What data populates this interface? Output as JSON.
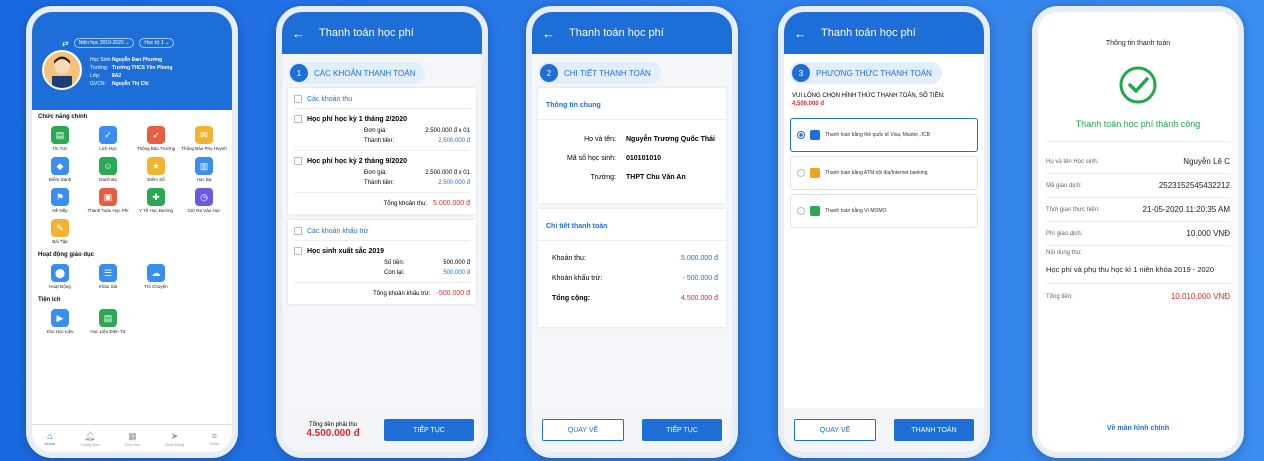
{
  "home": {
    "year_label": "Niên học 2019-2020",
    "term_label": "Học kỳ 1",
    "info": [
      [
        "Học Sinh:",
        "Nguyễn Đan Phương"
      ],
      [
        "Trường:",
        "Trường THCS Yên Phong"
      ],
      [
        "Lớp:",
        "8A2"
      ],
      [
        "GVCN:",
        "Nguyễn Thị Chi"
      ]
    ],
    "sec_main": "Chức năng chính",
    "main_items": [
      {
        "label": "Tin Tức",
        "icon": "chart-icon",
        "color": "#2aa852"
      },
      {
        "label": "Lịch Học",
        "icon": "check-icon",
        "color": "#3a8ef0"
      },
      {
        "label": "Thông Báo Trường",
        "icon": "rocket-icon",
        "color": "#e85c44"
      },
      {
        "label": "Thông Báo Phụ Huynh",
        "icon": "message-icon",
        "color": "#f2b430"
      },
      {
        "label": "Điểm Danh",
        "icon": "shield-icon",
        "color": "#3a8ef0"
      },
      {
        "label": "Danh Bạ",
        "icon": "contact-icon",
        "color": "#2aa852"
      },
      {
        "label": "Điểm Số",
        "icon": "score-icon",
        "color": "#f2b430"
      },
      {
        "label": "Học Bạ",
        "icon": "book-icon",
        "color": "#3a8ef0"
      },
      {
        "label": "Nề Nếp",
        "icon": "rules-icon",
        "color": "#3a8ef0"
      },
      {
        "label": "Thanh Toán Học Phí",
        "icon": "wallet-icon",
        "color": "#e85c44"
      },
      {
        "label": "Y Tế Học Đường",
        "icon": "medical-icon",
        "color": "#2aa852"
      },
      {
        "label": "Giờ Ra Vào Học",
        "icon": "clock-icon",
        "color": "#6a5be0"
      },
      {
        "label": "Bài Tập",
        "icon": "homework-icon",
        "color": "#f2b430"
      }
    ],
    "sec_activity": "Hoạt động giáo dục",
    "activity_items": [
      {
        "label": "Hoạt Động",
        "icon": "location-icon",
        "color": "#3a8ef0"
      },
      {
        "label": "Khảo Sát",
        "icon": "survey-icon",
        "color": "#3a8ef0"
      },
      {
        "label": "Trò Chuyện",
        "icon": "chat-icon",
        "color": "#3a8ef0"
      }
    ],
    "sec_util": "Tiện ích",
    "util_items": [
      {
        "label": "Kho Học Liệu",
        "icon": "library-icon",
        "color": "#3a8ef0"
      },
      {
        "label": "Học Liệu Điện Tử",
        "icon": "ebook-icon",
        "color": "#2aa852"
      }
    ],
    "tabs": [
      "Home",
      "Thông Báo",
      "Lịch Học",
      "Hoạt Động",
      "Thêm"
    ]
  },
  "pay1": {
    "title": "Thanh toán học phí",
    "step_num": "1",
    "step": "CÁC KHOẢN THANH TOÁN",
    "sec_income": "Các khoản thu",
    "items": [
      {
        "name": "Học phí học kỳ 1 tháng 2/2020",
        "unit_label": "Đơn giá:",
        "unit": "2.500.000 đ x 01",
        "total_label": "Thành tiền:",
        "total": "2.500.000 đ"
      },
      {
        "name": "Học phí học kỳ 2 tháng 9/2020",
        "unit_label": "Đơn giá:",
        "unit": "2.500.000 đ x 01",
        "total_label": "Thành tiền:",
        "total": "2.500.000 đ"
      }
    ],
    "sum_label": "Tổng khoản thu:",
    "sum": "5.000.000 đ",
    "sec_deduct": "Các khoản khấu trừ",
    "deduct_name": "Học sinh xuất sắc 2019",
    "amount_label": "Số tiền:",
    "amount": "500.000 đ",
    "remain_label": "Còn lại:",
    "remain": "500.000 đ",
    "deduct_sum_label": "Tổng khoản khấu trừ:",
    "deduct_sum": "-500.000 đ",
    "pay_label": "Tổng tiền phải thu",
    "pay_total": "4.500.000 đ",
    "continue": "TIẾP TỤC"
  },
  "pay2": {
    "title": "Thanh toán học phí",
    "step_num": "2",
    "step": "CHI TIẾT THANH TOÁN",
    "general": "Thông tin chung",
    "fields": [
      [
        "Họ và tên:",
        "Nguyễn Trương Quốc Thái"
      ],
      [
        "Mã số học sinh:",
        "010101010"
      ],
      [
        "Trường:",
        "THPT Chu Văn An"
      ]
    ],
    "detail": "Chi tiết thanh toán",
    "lines": [
      [
        "Khoản thu:",
        "5.000.000 đ"
      ],
      [
        "Khoản khấu trừ:",
        "- 500.000 đ"
      ],
      [
        "Tổng cộng:",
        "4.500.000 đ"
      ]
    ],
    "back": "QUAY VỀ",
    "continue": "TIẾP TỤC"
  },
  "pay3": {
    "title": "Thanh toán học phí",
    "step_num": "3",
    "step": "PHƯƠNG THỨC THANH TOÁN",
    "prompt": "VUI LÒNG CHỌN HÌNH THỨC THANH TOÁN, SỐ TIỀN:",
    "amount": "4,500,000 đ",
    "options": [
      {
        "label": "Thanh toán bằng thẻ quốc tế Visa, Master, JCB",
        "icon": "bank-icon",
        "color": "#1e6ed8"
      },
      {
        "label": "Thanh toán bằng ATM nội địa/Internet banking",
        "icon": "atm-card-icon",
        "color": "#f2a020"
      },
      {
        "label": "Thanh toán bằng Ví MOMO",
        "icon": "momo-icon",
        "color": "#2aa852"
      }
    ],
    "back": "QUAY VỀ",
    "pay": "THANH TOÁN"
  },
  "result": {
    "title": "Thông tin thanh toán",
    "success": "Thanh toán học phí thành công",
    "rows": [
      [
        "Họ và tên Học sinh:",
        "Nguyễn Lê C"
      ],
      [
        "Mã giao dịch:",
        "2523152545432212"
      ],
      [
        "Thời gian thực hiện:",
        "21-05-2020 11:20:35 AM"
      ],
      [
        "Phí giao dịch:",
        "10.000 VNĐ"
      ]
    ],
    "content_label": "Nội dung thu:",
    "content": "Học phí và phụ thu học kì 1 niên khóa 2019 - 2020",
    "total_label": "Tổng tiền:",
    "total": "10.010.000 VNĐ",
    "home_link": "Về màn hình chính"
  }
}
